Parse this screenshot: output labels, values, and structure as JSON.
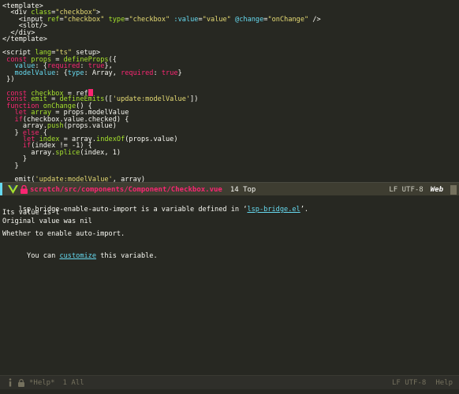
{
  "code": {
    "lines": [
      [
        {
          "t": "<template>",
          "c": "tag"
        }
      ],
      [
        {
          "t": "  <div ",
          "c": "tag"
        },
        {
          "t": "class",
          "c": "attr"
        },
        {
          "t": "=",
          "c": "tag"
        },
        {
          "t": "\"checkbox\"",
          "c": "str"
        },
        {
          "t": ">",
          "c": "tag"
        }
      ],
      [
        {
          "t": "    <input ",
          "c": "tag"
        },
        {
          "t": "ref",
          "c": "attr"
        },
        {
          "t": "=",
          "c": "tag"
        },
        {
          "t": "\"checkbox\"",
          "c": "str"
        },
        {
          "t": " ",
          "c": "tag"
        },
        {
          "t": "type",
          "c": "attr"
        },
        {
          "t": "=",
          "c": "tag"
        },
        {
          "t": "\"checkbox\"",
          "c": "str"
        },
        {
          "t": " ",
          "c": "tag"
        },
        {
          "t": ":value",
          "c": "prop"
        },
        {
          "t": "=",
          "c": "tag"
        },
        {
          "t": "\"value\"",
          "c": "str"
        },
        {
          "t": " ",
          "c": "tag"
        },
        {
          "t": "@change",
          "c": "prop"
        },
        {
          "t": "=",
          "c": "tag"
        },
        {
          "t": "\"onChange\"",
          "c": "str"
        },
        {
          "t": " />",
          "c": "tag"
        }
      ],
      [
        {
          "t": "    <slot/>",
          "c": "tag"
        }
      ],
      [
        {
          "t": "  </div>",
          "c": "tag"
        }
      ],
      [
        {
          "t": "</template>",
          "c": "tag"
        }
      ],
      [],
      [
        {
          "t": "<script ",
          "c": "tag"
        },
        {
          "t": "lang",
          "c": "attr"
        },
        {
          "t": "=",
          "c": "tag"
        },
        {
          "t": "\"ts\"",
          "c": "str"
        },
        {
          "t": " setup>",
          "c": "tag"
        }
      ],
      [
        {
          "t": " const ",
          "c": "kw"
        },
        {
          "t": "props",
          "c": "fn"
        },
        {
          "t": " = ",
          "c": "tag"
        },
        {
          "t": "defineProps",
          "c": "fn"
        },
        {
          "t": "({",
          "c": "tag"
        }
      ],
      [
        {
          "t": "   value",
          "c": "prop"
        },
        {
          "t": ": {",
          "c": "tag"
        },
        {
          "t": "required",
          "c": "kw"
        },
        {
          "t": ": ",
          "c": "tag"
        },
        {
          "t": "true",
          "c": "kw"
        },
        {
          "t": "},",
          "c": "tag"
        }
      ],
      [
        {
          "t": "   modelValue",
          "c": "prop"
        },
        {
          "t": ": {",
          "c": "tag"
        },
        {
          "t": "type",
          "c": "prop"
        },
        {
          "t": ": Array, ",
          "c": "tag"
        },
        {
          "t": "required",
          "c": "kw"
        },
        {
          "t": ": ",
          "c": "tag"
        },
        {
          "t": "true",
          "c": "kw"
        },
        {
          "t": "}",
          "c": "tag"
        }
      ],
      [
        {
          "t": " })",
          "c": "tag"
        }
      ],
      [],
      [
        {
          "t": " const ",
          "c": "kw"
        },
        {
          "t": "checkbox",
          "c": "fn"
        },
        {
          "t": " = ref",
          "c": "tag"
        },
        {
          "t": "",
          "c": "cursor"
        }
      ],
      [
        {
          "t": " const ",
          "c": "kw"
        },
        {
          "t": "emit",
          "c": "fn"
        },
        {
          "t": " = ",
          "c": "tag"
        },
        {
          "t": "defineEmits",
          "c": "fn"
        },
        {
          "t": "([",
          "c": "tag"
        },
        {
          "t": "'update:modelValue'",
          "c": "str"
        },
        {
          "t": "])",
          "c": "tag"
        }
      ],
      [
        {
          "t": " function ",
          "c": "kw"
        },
        {
          "t": "onChange",
          "c": "fn"
        },
        {
          "t": "() {",
          "c": "tag"
        }
      ],
      [
        {
          "t": "   let ",
          "c": "kw"
        },
        {
          "t": "array",
          "c": "fn"
        },
        {
          "t": " = props.modelValue",
          "c": "tag"
        }
      ],
      [
        {
          "t": "   if",
          "c": "kw"
        },
        {
          "t": "(checkbox.value.checked) {",
          "c": "tag"
        }
      ],
      [
        {
          "t": "     array.",
          "c": "tag"
        },
        {
          "t": "push",
          "c": "fn"
        },
        {
          "t": "(props.value)",
          "c": "tag"
        }
      ],
      [
        {
          "t": "   } ",
          "c": "tag"
        },
        {
          "t": "else",
          "c": "kw"
        },
        {
          "t": " {",
          "c": "tag"
        }
      ],
      [
        {
          "t": "     let ",
          "c": "kw"
        },
        {
          "t": "index",
          "c": "fn"
        },
        {
          "t": " = array.",
          "c": "tag"
        },
        {
          "t": "indexOf",
          "c": "fn"
        },
        {
          "t": "(props.value)",
          "c": "tag"
        }
      ],
      [
        {
          "t": "     if",
          "c": "kw"
        },
        {
          "t": "(index != -1) {",
          "c": "tag"
        }
      ],
      [
        {
          "t": "       array.",
          "c": "tag"
        },
        {
          "t": "splice",
          "c": "fn"
        },
        {
          "t": "(index, 1)",
          "c": "tag"
        }
      ],
      [
        {
          "t": "     }",
          "c": "tag"
        }
      ],
      [
        {
          "t": "   }",
          "c": "tag"
        }
      ],
      [],
      [
        {
          "t": "   emit(",
          "c": "tag"
        },
        {
          "t": "'update:modelValue'",
          "c": "str"
        },
        {
          "t": ", array)",
          "c": "tag"
        }
      ]
    ]
  },
  "modeline_top": {
    "file_path": "scratch/src/components/Component/Checkbox.vue",
    "position": "14 Top",
    "encoding": "LF UTF-8",
    "mode": "Web"
  },
  "help": {
    "var_name_prefix": "lsp-bridge-enable-auto-import",
    "defined_text": " is a variable defined in ‘",
    "file_link": "lsp-bridge.el",
    "defined_end": "’.",
    "value_line": "Its value is t",
    "original_line": "Original value was nil",
    "doc_line": "Whether to enable auto-import.",
    "customize_prefix": "  You can ",
    "customize_link": "customize",
    "customize_suffix": " this variable."
  },
  "modeline_bottom": {
    "buffer_name": "*Help*",
    "position": "1 All",
    "encoding": "LF UTF-8",
    "mode": "Help"
  }
}
